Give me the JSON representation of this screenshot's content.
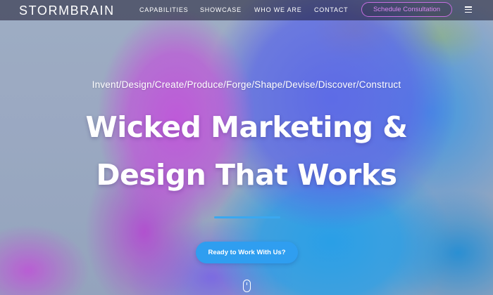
{
  "header": {
    "logo": "STORMBRAIN",
    "nav": [
      "CAPABILITIES",
      "SHOWCASE",
      "WHO WE ARE",
      "CONTACT"
    ],
    "cta_label": "Schedule Consultation",
    "menu_icon": "hamburger-menu-icon"
  },
  "hero": {
    "tagline": "Invent/Design/Create/Produce/Forge/Shape/Devise/Discover/Construct",
    "headline_line1": "Wicked Marketing &",
    "headline_line2": "Design That Works",
    "cta_label": "Ready to Work With Us?",
    "scroll_icon": "mouse-scroll-icon"
  },
  "colors": {
    "accent_blue": "#2f9ef0",
    "accent_purple": "#c56ee0",
    "nav_bg": "#1c1a30"
  }
}
